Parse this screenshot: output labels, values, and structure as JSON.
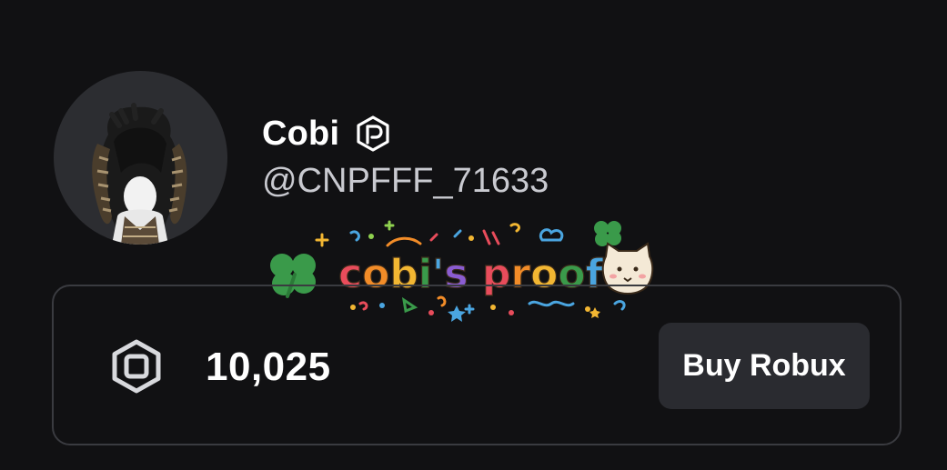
{
  "profile": {
    "display_name": "Cobi",
    "username": "@CNPFFF_71633",
    "verified_icon": "verified-badge-icon"
  },
  "sticker": {
    "text": "cobi's proof"
  },
  "robux": {
    "icon": "robux-icon",
    "balance": "10,025",
    "buy_label": "Buy Robux"
  },
  "colors": {
    "background": "#111113",
    "avatar_bg": "#2c2d31",
    "panel_border": "#3a3b40",
    "button_bg": "#2a2b30",
    "text_primary": "#ffffff",
    "text_secondary": "#c9cad0"
  }
}
